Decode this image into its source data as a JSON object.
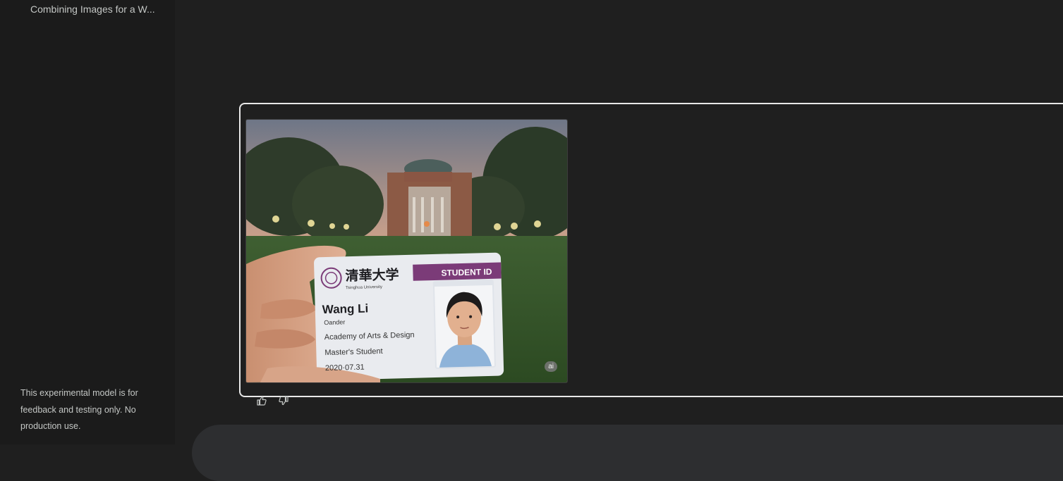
{
  "sidebar": {
    "recent_chat": "Combining Images for a W...",
    "disclaimer": "This experimental model is for feedback and testing only. No production use."
  },
  "generated_image": {
    "card": {
      "university_cn": "清華大学",
      "university_en": "Tsinghua University",
      "banner": "STUDENT ID",
      "name": "Wang Li",
      "gender": "Oander",
      "department": "Academy of Arts & Design",
      "level": "Master's Student",
      "date": "2020·07.31"
    },
    "badge": "ai"
  },
  "feedback": {
    "like_icon": "thumbs-up-icon",
    "dislike_icon": "thumbs-down-icon"
  },
  "colors": {
    "background": "#1f1f1f",
    "sidebar": "#1b1b1b",
    "banner": "#7b3b78"
  }
}
